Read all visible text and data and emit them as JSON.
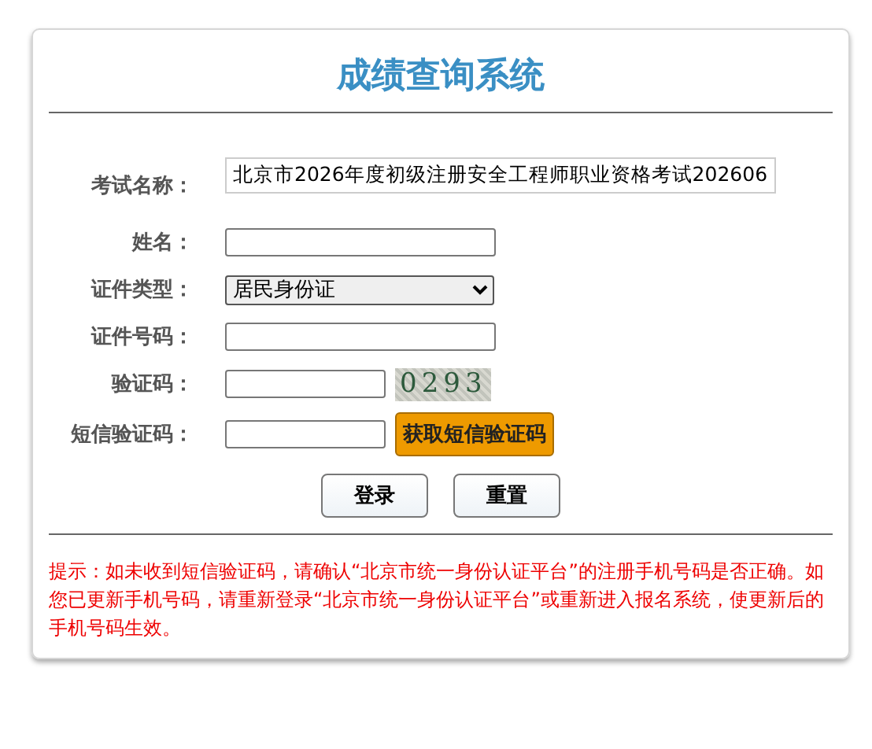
{
  "title": "成绩查询系统",
  "fields": [
    {
      "kind": "readonly",
      "label": "考试名称：",
      "value": "北京市2026年度初级注册安全工程师职业资格考试202606"
    },
    {
      "kind": "input",
      "label": "姓名："
    },
    {
      "kind": "select",
      "label": "证件类型：",
      "value": "居民身份证"
    },
    {
      "kind": "input",
      "label": "证件号码："
    },
    {
      "kind": "captcha",
      "label": "验证码：",
      "captcha": "0293"
    },
    {
      "kind": "sms",
      "label": "短信验证码：",
      "button": "获取短信验证码"
    }
  ],
  "buttons": [
    "登录",
    "重置"
  ],
  "notice": "提示：如未收到短信验证码，请确认“北京市统一身份认证平台”的注册手机号码是否正确。如您已更新手机号码，请重新登录“北京市统一身份认证平台”或重新进入报名系统，使更新后的手机号码生效。"
}
